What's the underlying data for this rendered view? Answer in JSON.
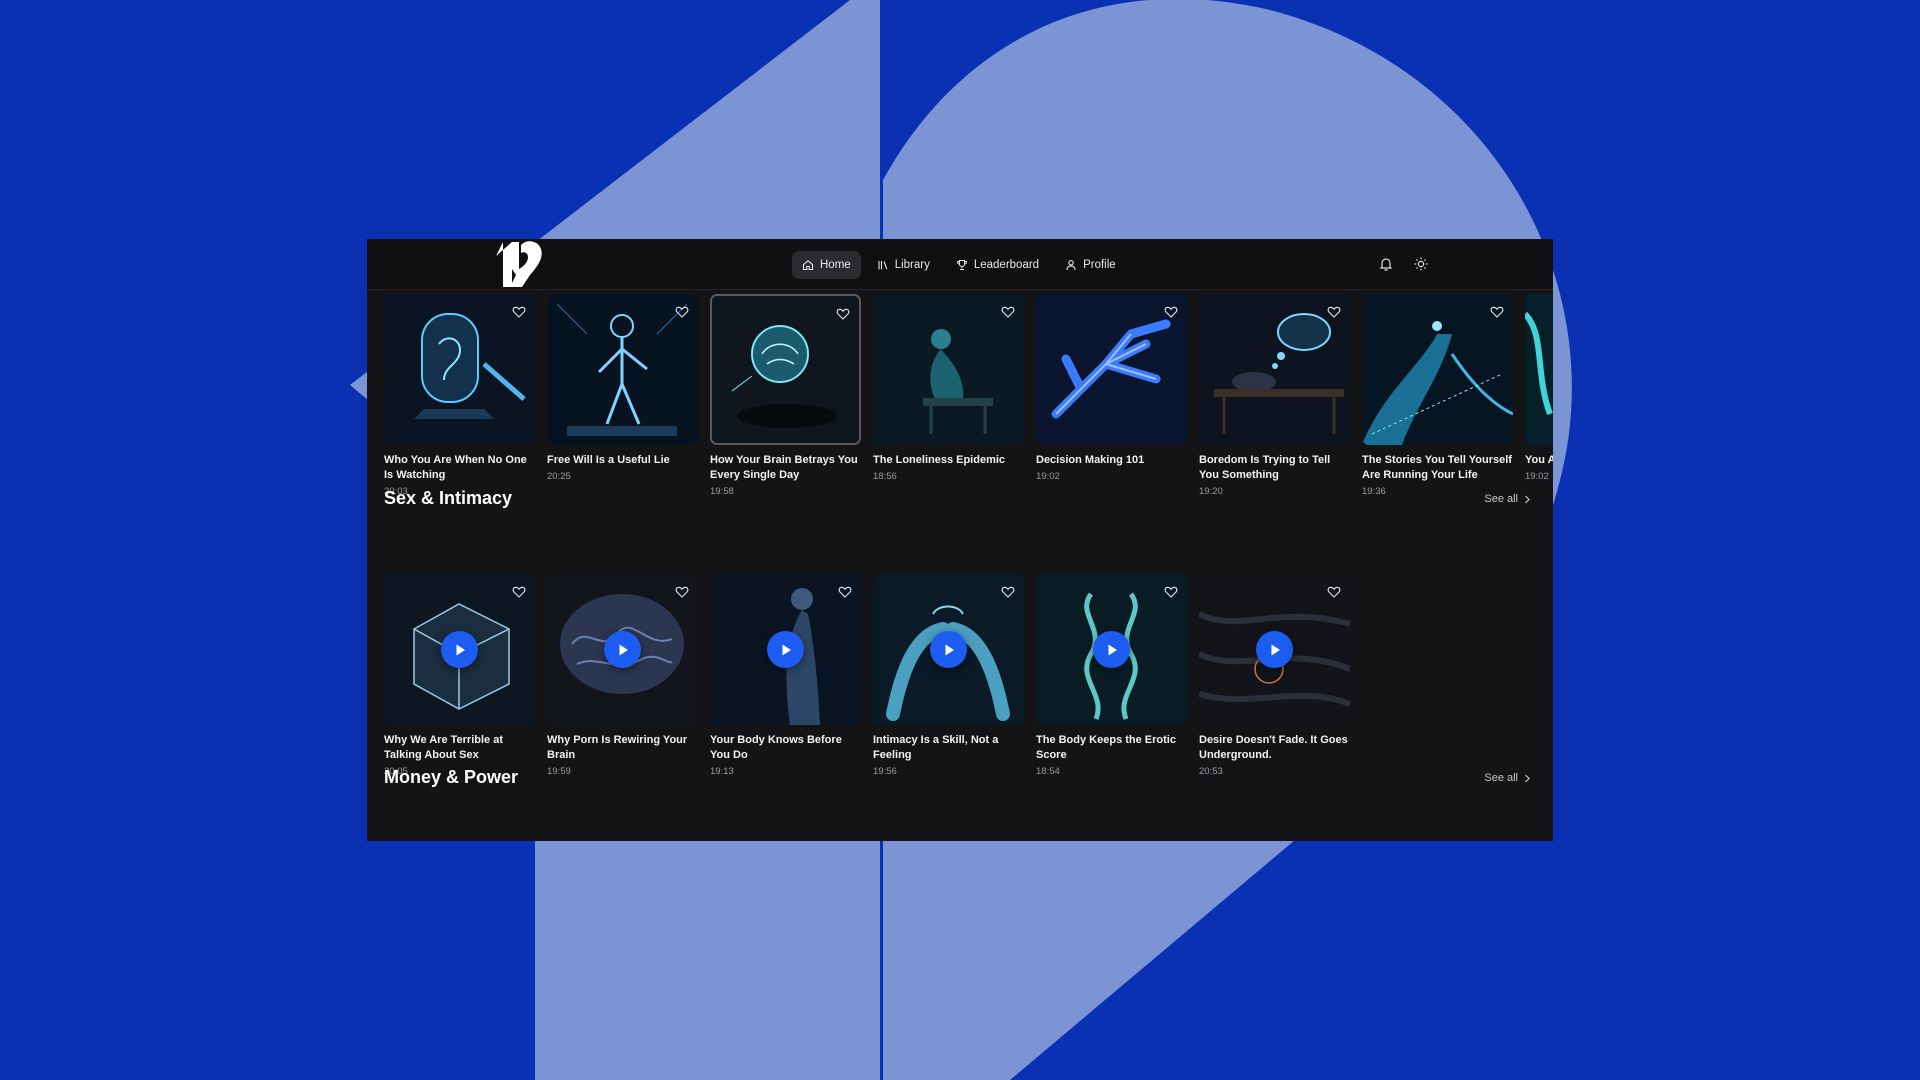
{
  "nav": {
    "items": [
      {
        "label": "Home",
        "icon": "home-icon",
        "active": true
      },
      {
        "label": "Library",
        "icon": "library-icon",
        "active": false
      },
      {
        "label": "Leaderboard",
        "icon": "trophy-icon",
        "active": false
      },
      {
        "label": "Profile",
        "icon": "user-icon",
        "active": false
      }
    ]
  },
  "colors": {
    "background": "#0a31b3",
    "app_bg": "#141416",
    "accent": "#1d5cf0"
  },
  "rows": [
    {
      "title": "",
      "cards": [
        {
          "title": "Who You Are When No One Is Watching",
          "duration": "20:03"
        },
        {
          "title": "Free Will Is a Useful Lie",
          "duration": "20:25"
        },
        {
          "title": "How Your Brain Betrays You Every Single Day",
          "duration": "19:58"
        },
        {
          "title": "The Loneliness Epidemic",
          "duration": "18:56"
        },
        {
          "title": "Decision Making 101",
          "duration": "19:02"
        },
        {
          "title": "Boredom Is Trying to Tell You Something",
          "duration": "19:20"
        },
        {
          "title": "The Stories You Tell Yourself Are Running Your Life",
          "duration": "19:36"
        },
        {
          "title": "You A",
          "duration": "19:02"
        }
      ]
    },
    {
      "title": "Sex & Intimacy",
      "see_all": "See all",
      "cards": [
        {
          "title": "Why We Are Terrible at Talking About Sex",
          "duration": "20:05"
        },
        {
          "title": "Why Porn Is Rewiring Your Brain",
          "duration": "19:59"
        },
        {
          "title": "Your Body Knows Before You Do",
          "duration": "19:13"
        },
        {
          "title": "Intimacy Is a Skill, Not a Feeling",
          "duration": "19:56"
        },
        {
          "title": "The Body Keeps the Erotic Score",
          "duration": "18:54"
        },
        {
          "title": "Desire Doesn't Fade. It Goes Underground.",
          "duration": "20:53"
        }
      ]
    },
    {
      "title": "Money & Power",
      "see_all": "See all",
      "cards": []
    }
  ]
}
